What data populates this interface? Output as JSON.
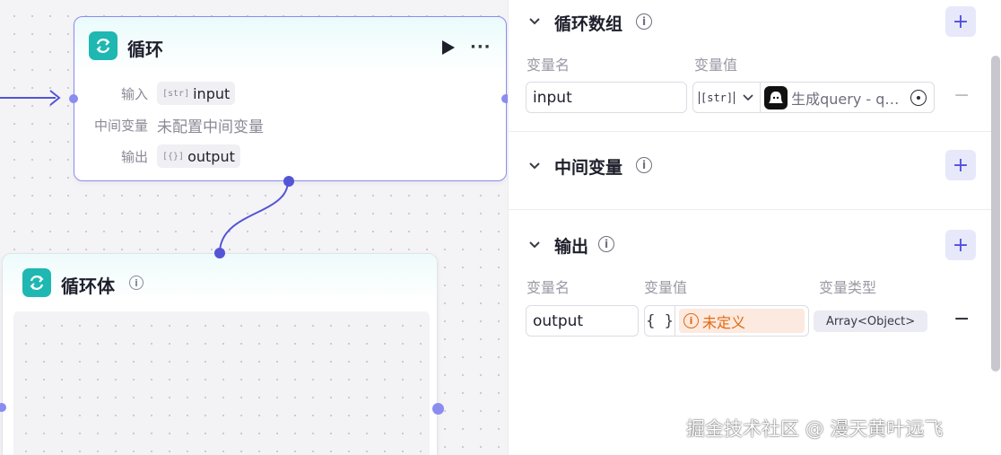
{
  "canvas": {
    "loop_node": {
      "title": "循环",
      "params": [
        {
          "label": "输入",
          "type_mark": "[str]",
          "value": "input"
        },
        {
          "label": "中间变量",
          "value": "未配置中间变量"
        },
        {
          "label": "输出",
          "type_mark": "[{}]",
          "value": "output"
        }
      ]
    },
    "loop_body_node": {
      "title": "循环体"
    }
  },
  "panel": {
    "loop_array": {
      "title": "循环数组",
      "col_name": "变量名",
      "col_value": "变量值",
      "row": {
        "name": "input",
        "type": "[str]",
        "ref_text": "生成query - q…"
      },
      "remove_label": "−"
    },
    "intermediate": {
      "title": "中间变量"
    },
    "output": {
      "title": "输出",
      "col_name": "变量名",
      "col_value": "变量值",
      "col_type": "变量类型",
      "row": {
        "name": "output",
        "braces": "{ }",
        "status": "未定义",
        "var_type": "Array<Object>"
      },
      "remove_label": "−"
    },
    "add_label": "+",
    "info_label": "i"
  },
  "watermark": "掘金技术社区 @ 漫天黄叶远飞",
  "colors": {
    "accent": "#5355d6",
    "node_icon": "#1fb7b1",
    "warning": "#e2680f",
    "warning_bg": "#fce9df"
  }
}
